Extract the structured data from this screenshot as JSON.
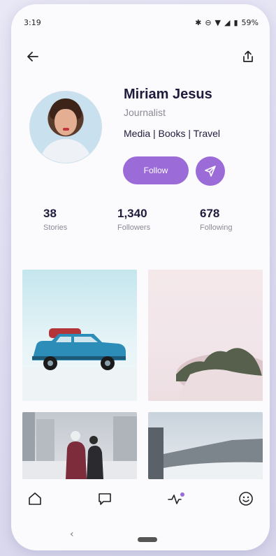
{
  "status_bar": {
    "time": "3:19",
    "battery": "59%"
  },
  "profile": {
    "name": "Miriam Jesus",
    "role": "Journalist",
    "tags": "Media | Books | Travel",
    "follow_label": "Follow"
  },
  "stats": [
    {
      "value": "38",
      "label": "Stories"
    },
    {
      "value": "1,340",
      "label": "Followers"
    },
    {
      "value": "678",
      "label": "Following"
    }
  ],
  "colors": {
    "accent": "#9b6bd8",
    "text_primary": "#1e1b3c",
    "text_secondary": "#8a8a98"
  },
  "icons": {
    "back": "arrow-left-icon",
    "share": "share-icon",
    "send": "send-icon",
    "home": "home-icon",
    "messages": "message-icon",
    "activity": "activity-icon",
    "profile": "smiley-icon"
  }
}
